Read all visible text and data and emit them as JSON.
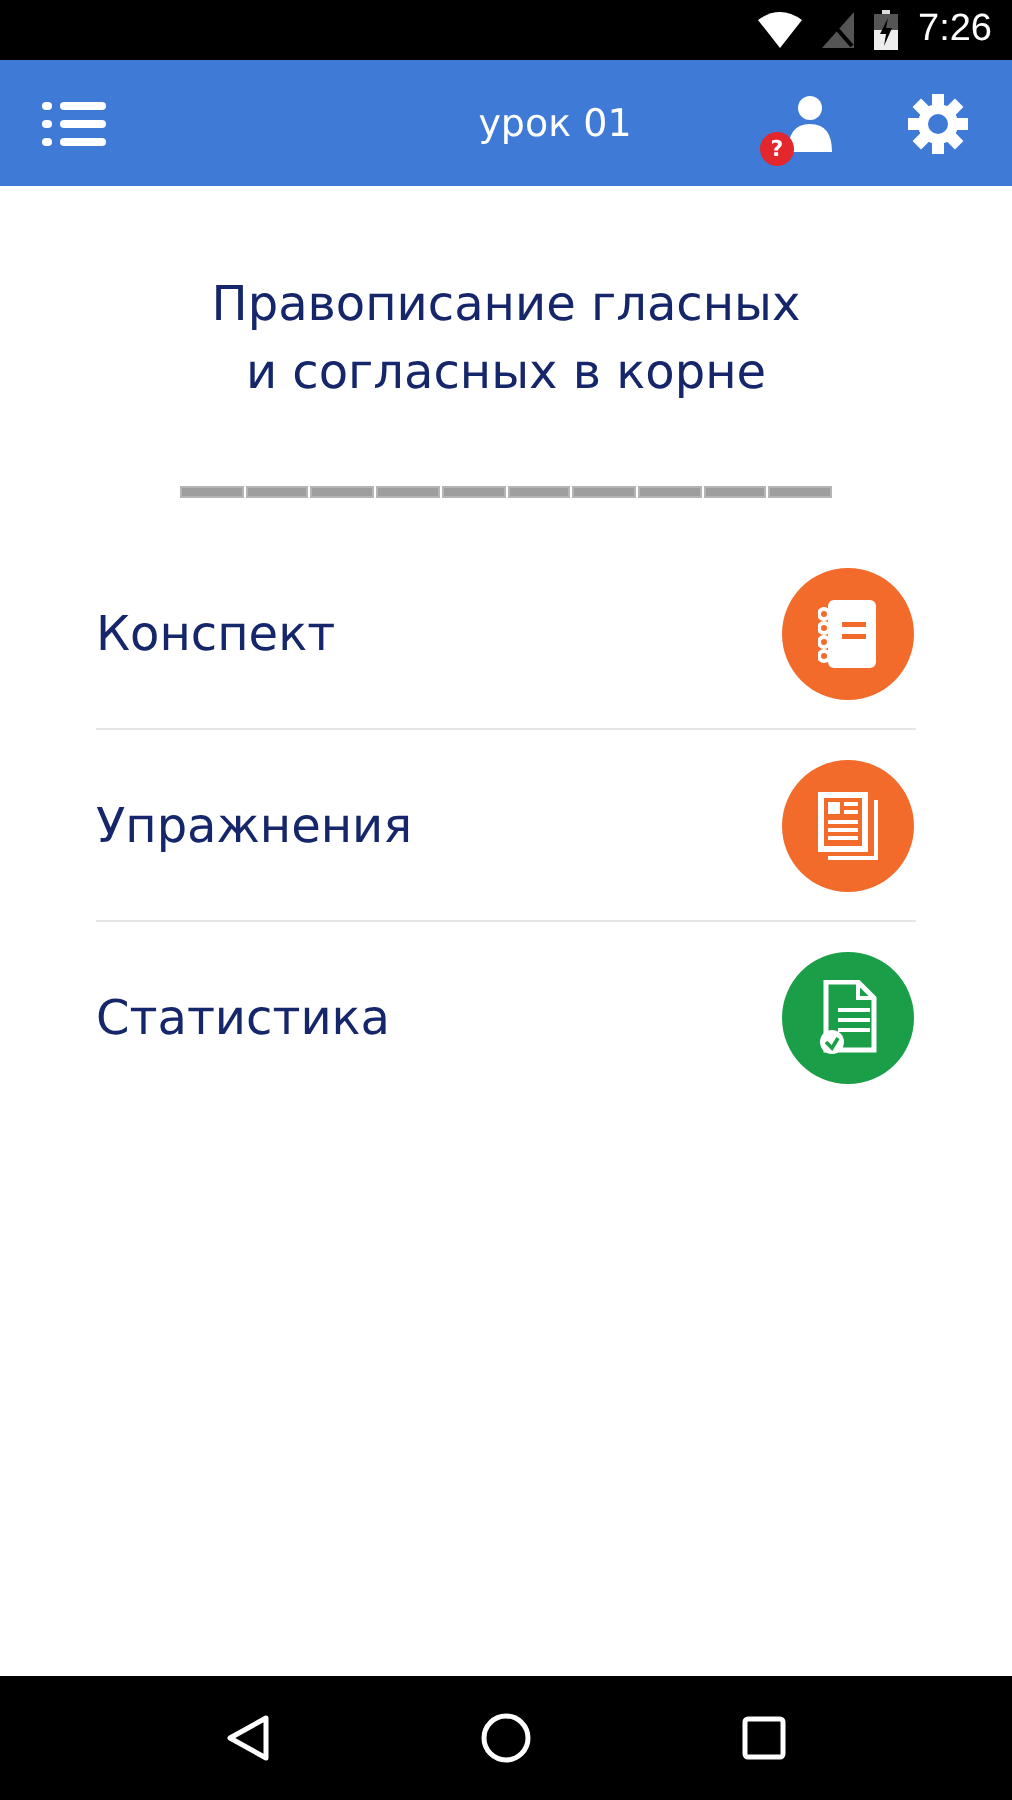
{
  "status_bar": {
    "time": "7:26"
  },
  "app_bar": {
    "title": "урок 01",
    "help_badge": "?"
  },
  "lesson": {
    "title": "Правописание гласных\nи согласных в корне",
    "progress_segments": [
      {
        "done": false
      },
      {
        "done": false
      },
      {
        "done": false
      },
      {
        "done": false
      },
      {
        "done": false
      },
      {
        "done": false
      },
      {
        "done": false
      },
      {
        "done": false
      },
      {
        "done": false
      },
      {
        "done": false
      }
    ]
  },
  "menu": [
    {
      "label": "Конспект",
      "kind": "notes",
      "color": "#f26b2a"
    },
    {
      "label": "Упражнения",
      "kind": "exercises",
      "color": "#f26b2a"
    },
    {
      "label": "Статистика",
      "kind": "stats",
      "color": "#1a9e48"
    }
  ]
}
